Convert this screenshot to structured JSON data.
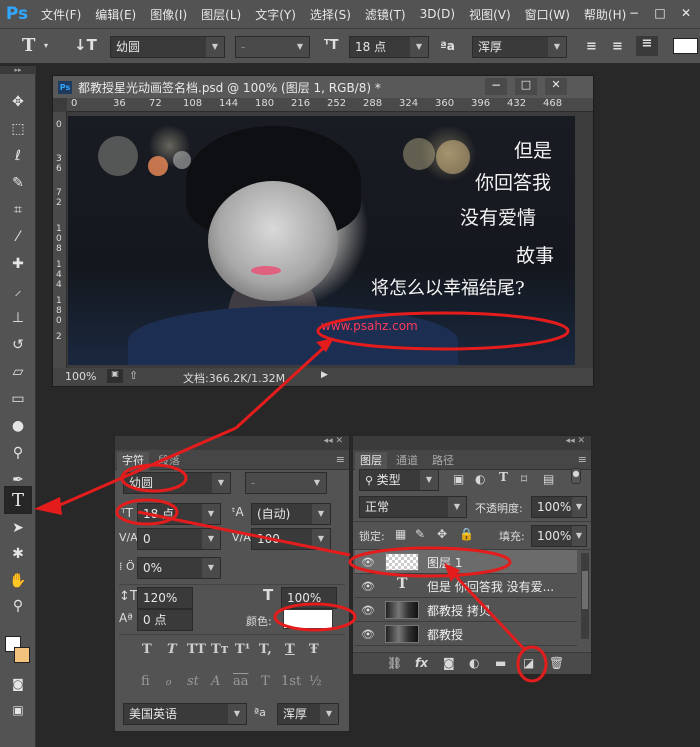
{
  "menubar": {
    "logo": "Ps",
    "items": [
      "文件(F)",
      "编辑(E)",
      "图像(I)",
      "图层(L)",
      "文字(Y)",
      "选择(S)",
      "滤镜(T)",
      "3D(D)",
      "视图(V)",
      "窗口(W)",
      "帮助(H)"
    ],
    "window_controls": [
      "−",
      "□",
      "✕"
    ]
  },
  "options": {
    "tool_glyph": "T",
    "font_family": "幼圆",
    "font_style": "-",
    "font_size": "18 点",
    "aa_label": "ªa",
    "antialias": "浑厚"
  },
  "document": {
    "title": "都教授星光动画签名档.psd @ 100% (图层 1, RGB/8) *",
    "ruler_h": [
      "0",
      "36",
      "72",
      "108",
      "144",
      "180",
      "216",
      "252",
      "288",
      "324",
      "360",
      "396",
      "432",
      "468"
    ],
    "ruler_v": [
      "0",
      "3",
      "6",
      "7",
      "2",
      "1",
      "0",
      "8",
      "1",
      "4",
      "4",
      "1",
      "8",
      "0",
      "2"
    ],
    "poem_lines": [
      "但是",
      "你回答我",
      "没有爱情",
      "故事",
      "将怎么以幸福结尾?"
    ],
    "watermark": "www.psahz.com",
    "zoom": "100%",
    "doc_size": "文档:366.2K/1.32M"
  },
  "char_panel": {
    "tabs": [
      "字符",
      "段落"
    ],
    "font_family": "幼圆",
    "font_style": "-",
    "font_size": "18 点",
    "leading": "(自动)",
    "kerning": "0",
    "tracking": "100",
    "tsume": "0%",
    "vscale": "120%",
    "hscale": "100%",
    "baseline": "0 点",
    "color_label": "颜色:",
    "color_value": "#ffffff",
    "type_buttons": [
      "T",
      "T",
      "TT",
      "Tт",
      "T¹",
      "T,",
      "T",
      "Ŧ"
    ],
    "ot_buttons": [
      "fi",
      "ℴ",
      "st",
      "A",
      "aa",
      "T",
      "1st",
      "½"
    ],
    "language": "美国英语",
    "aa_label": "ªa",
    "antialias": "浑厚"
  },
  "layers_panel": {
    "tabs": [
      "图层",
      "通道",
      "路径"
    ],
    "filter": "类型",
    "blend_mode": "正常",
    "opacity_label": "不透明度:",
    "opacity": "100%",
    "lock_label": "锁定:",
    "fill_label": "填充:",
    "fill": "100%",
    "layers": [
      {
        "name": "图层 1",
        "type": "pixel",
        "selected": true
      },
      {
        "name": "但是 你回答我 没有爱...",
        "type": "text",
        "selected": false
      },
      {
        "name": "都教授 拷贝",
        "type": "image",
        "selected": false
      },
      {
        "name": "都教授",
        "type": "image",
        "selected": false
      }
    ],
    "footer_icons": [
      "link-icon",
      "fx-icon",
      "mask-icon",
      "adjustment-icon",
      "group-icon",
      "new-layer-icon",
      "trash-icon"
    ],
    "fx_label": "fx"
  },
  "annotation_color": "#e41c1c"
}
